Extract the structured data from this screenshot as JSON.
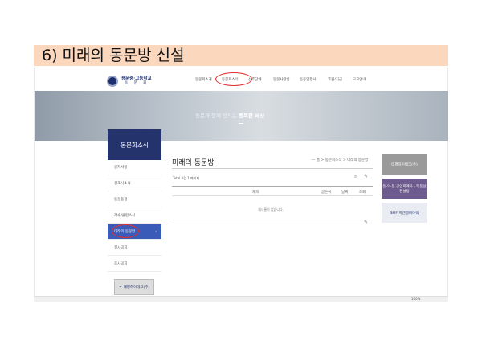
{
  "slide": {
    "title": "6) 미래의 동문방 신설"
  },
  "logo": {
    "main": "용문중·고등학교",
    "sub": "동 문 회"
  },
  "nav": [
    "동문회소개",
    "동문회소식",
    "선후단체",
    "동문사랑방",
    "동동업행사",
    "후원/기금",
    "모교안내"
  ],
  "banner": {
    "pre": "동문과 함께 만드는 ",
    "bold": "행복한 세상"
  },
  "sidebar": {
    "heading": "동문회소식",
    "items": [
      "공지사항",
      "경조사소식",
      "동문동정",
      "각수/클럽소식",
      "미래의 동문방",
      "결시공지",
      "조사공지"
    ],
    "active_index": 4,
    "active_arrow": "›",
    "sponsor": "태평하이테크(주)"
  },
  "main": {
    "title": "미래의 동문방",
    "breadcrumb": "— 홈  >  동문회소식  >  미래의 동문방",
    "total": "Total 0건 1 페이지",
    "search_icon": "⌕",
    "write_icon": "✎",
    "columns": [
      "제목",
      "글쓴이",
      "날짜",
      "조회"
    ],
    "empty": "게시물이 없습니다."
  },
  "ads": [
    {
      "label": "태평하이테크(주)",
      "bg": "#9a9a9a",
      "color": "#fff"
    },
    {
      "label": "동·의·봉 공인회계사 / 부동산컨설팅",
      "bg": "#6d5a8e",
      "color": "#fff"
    },
    {
      "label": "SMF  지엔엘메이텍",
      "bg": "#e9ecf2",
      "color": "#1d2f6e"
    }
  ],
  "status": {
    "zoom": "100%"
  }
}
